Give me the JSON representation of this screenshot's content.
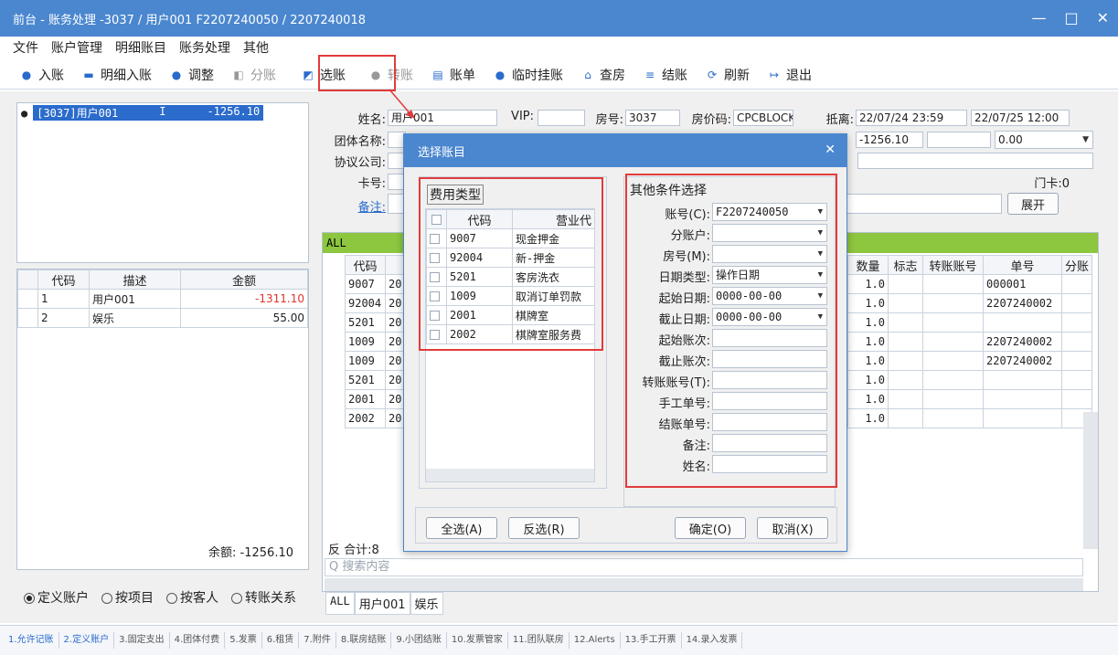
{
  "window": {
    "title": "前台 - 账务处理 -3037 / 用户001 F2207240050 / 2207240018",
    "min": "—",
    "max": "□",
    "close": "✕"
  },
  "menu": [
    "文件",
    "账户管理",
    "明细账目",
    "账务处理",
    "其他"
  ],
  "toolbar": [
    {
      "label": "入账",
      "icon": "●"
    },
    {
      "label": "明细入账",
      "icon": "▬"
    },
    {
      "label": "调整",
      "icon": "●"
    },
    {
      "label": "分账",
      "icon": "◧"
    },
    {
      "label": "选账",
      "icon": "◩"
    },
    {
      "label": "转账",
      "icon": "●"
    },
    {
      "label": "账单",
      "icon": "▤"
    },
    {
      "label": "临时挂账",
      "icon": "●"
    },
    {
      "label": "查房",
      "icon": "⌂"
    },
    {
      "label": "结账",
      "icon": "≡"
    },
    {
      "label": "刷新",
      "icon": "⟳"
    },
    {
      "label": "退出",
      "icon": "↦"
    }
  ],
  "tree": {
    "item": "[3037]用户001",
    "flag": "I",
    "amount": "-1256.10"
  },
  "left_table": {
    "headers": [
      "代码",
      "描述",
      "金额"
    ],
    "rows": [
      [
        "1",
        "用户001",
        "-1311.10"
      ],
      [
        "2",
        "娱乐",
        "55.00"
      ]
    ]
  },
  "balance": "余额: -1256.10",
  "radios": [
    "定义账户",
    "按项目",
    "按客人",
    "转账关系"
  ],
  "guest": {
    "name_label": "姓名:",
    "name": "用户001",
    "vip_label": "VIP:",
    "vip": "",
    "room_label": "房号:",
    "room": "3037",
    "rate_label": "房价码:",
    "rate": "CPCBLOCK",
    "depart_label": "抵离:",
    "arrive": "22/07/24 23:59",
    "depart": "22/07/25 12:00",
    "group_label": "团体名称:",
    "company_label": "协议公司:",
    "card_label": "卡号:",
    "remark_label": "备注:",
    "balance_val": "-1256.10",
    "discount": "0.00",
    "doorcard": "门卡:0",
    "expand": "展开"
  },
  "main_grid": {
    "tab": "ALL",
    "left_headers": [
      "代码"
    ],
    "right_headers": [
      "数量",
      "标志",
      "转账账号",
      "单号",
      "分账"
    ],
    "rows": [
      {
        "code": "9007",
        "date": "20",
        "qty": "1.0",
        "no": "000001"
      },
      {
        "code": "92004",
        "date": "20",
        "qty": "1.0",
        "no": "2207240002"
      },
      {
        "code": "5201",
        "date": "20",
        "qty": "1.0",
        "no": ""
      },
      {
        "code": "1009",
        "date": "20",
        "qty": "1.0",
        "no": "2207240002"
      },
      {
        "code": "1009",
        "date": "20",
        "qty": "1.0",
        "no": "2207240002"
      },
      {
        "code": "5201",
        "date": "20",
        "qty": "1.0",
        "no": ""
      },
      {
        "code": "2001",
        "date": "20",
        "qty": "1.0",
        "no": ""
      },
      {
        "code": "2002",
        "date": "20",
        "qty": "1.0",
        "no": ""
      }
    ],
    "total": "反 合计:8",
    "search_placeholder": "Q 搜索内容",
    "bottom_tabs": [
      "ALL",
      "用户001",
      "娱乐"
    ]
  },
  "dialog": {
    "title": "选择账目",
    "fee_group": "费用类型",
    "fee_headers": [
      "代码",
      "营业代"
    ],
    "fee_rows": [
      [
        "9007",
        "现金押金"
      ],
      [
        "92004",
        "新-押金"
      ],
      [
        "5201",
        "客房洗衣"
      ],
      [
        "1009",
        "取消订单罚款"
      ],
      [
        "2001",
        "棋牌室"
      ],
      [
        "2002",
        "棋牌室服务费"
      ]
    ],
    "other_group": "其他条件选择",
    "fields": [
      {
        "label": "账号(C):",
        "value": "F2207240050",
        "type": "select"
      },
      {
        "label": "分账户:",
        "value": "",
        "type": "select"
      },
      {
        "label": "房号(M):",
        "value": "",
        "type": "select"
      },
      {
        "label": "日期类型:",
        "value": "操作日期",
        "type": "select"
      },
      {
        "label": "起始日期:",
        "value": "0000-00-00",
        "type": "select"
      },
      {
        "label": "截止日期:",
        "value": "0000-00-00",
        "type": "select"
      },
      {
        "label": "起始账次:",
        "value": "",
        "type": "text"
      },
      {
        "label": "截止账次:",
        "value": "",
        "type": "text"
      },
      {
        "label": "转账账号(T):",
        "value": "",
        "type": "text"
      },
      {
        "label": "手工单号:",
        "value": "",
        "type": "text"
      },
      {
        "label": "结账单号:",
        "value": "",
        "type": "text"
      },
      {
        "label": "备注:",
        "value": "",
        "type": "text"
      },
      {
        "label": "姓名:",
        "value": "",
        "type": "text"
      }
    ],
    "select_all": "全选(A)",
    "invert": "反选(R)",
    "ok": "确定(O)",
    "cancel": "取消(X)"
  },
  "status_tabs": [
    "1.允许记账",
    "2.定义账户",
    "3.固定支出",
    "4.团体付费",
    "5.发票",
    "6.租赁",
    "7.附件",
    "8.联房结账",
    "9.小团结账",
    "10.发票管家",
    "11.团队联房",
    "12.Alerts",
    "13.手工开票",
    "14.录入发票"
  ],
  "colors": {
    "title": "#4b87cf",
    "green": "#8dc63f",
    "red": "#e23b3b",
    "negative": "#e0342c"
  }
}
